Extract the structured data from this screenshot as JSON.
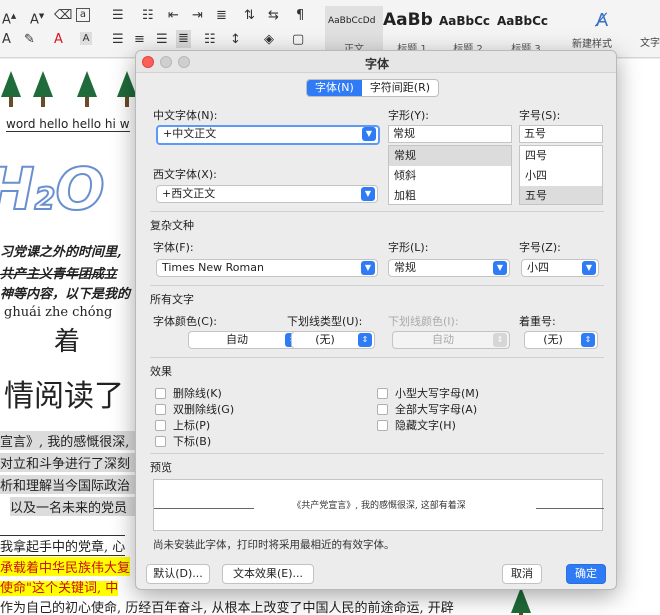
{
  "ribbon": {
    "styles": [
      {
        "sample": "AaBbCcDd",
        "name": "正文"
      },
      {
        "sample": "AaBb",
        "name": "标题 1"
      },
      {
        "sample": "AaBbCc",
        "name": "标题 2"
      },
      {
        "sample": "AaBbCc",
        "name": "标题 3"
      }
    ],
    "new_style_label": "新建样式",
    "text_label": "文字"
  },
  "document": {
    "line1": "word hello hello hi w",
    "line2": "习党课之外的时间里,",
    "line3": "共产主义青年团成立",
    "line4": "神等内容，以下是我的",
    "pinyin": "ghuái zhe chóng",
    "char_big": "着",
    "line5": "情阅读了",
    "para1": "宣言》, 我的感慨很深,",
    "para2": "对立和斗争进行了深刻",
    "para3": "析和理解当今国际政治",
    "para4": "以及一名未来的党员",
    "para5": "我拿起手中的党章, 心",
    "para6": "承载着中华民族伟大复",
    "para7": "使命\"这个关键词, 中",
    "para8": "作为自己的初心使命, 历经百年奋斗, 从根本上改变了中国人民的前途命运, 开辟"
  },
  "dialog": {
    "title": "字体",
    "tabs": [
      {
        "label": "字体(N)",
        "active": true
      },
      {
        "label": "字符间距(R)",
        "active": false
      }
    ],
    "chinese_font_label": "中文字体(N):",
    "chinese_font_value": "+中文正文",
    "western_font_label": "西文字体(X):",
    "western_font_value": "+西文正文",
    "style_label": "字形(Y):",
    "style_value": "常规",
    "style_options": [
      "常规",
      "倾斜",
      "加粗"
    ],
    "size_label": "字号(S):",
    "size_value": "五号",
    "size_options": [
      "四号",
      "小四",
      "五号"
    ],
    "complex_section": "复杂文种",
    "complex_font_label": "字体(F):",
    "complex_font_value": "Times New Roman",
    "complex_style_label": "字形(L):",
    "complex_style_value": "常规",
    "complex_size_label": "字号(Z):",
    "complex_size_value": "小四",
    "all_text_section": "所有文字",
    "font_color_label": "字体颜色(C):",
    "font_color_value": "自动",
    "underline_type_label": "下划线类型(U):",
    "underline_type_value": "(无)",
    "underline_color_label": "下划线颜色(I):",
    "underline_color_value": "自动",
    "emphasis_label": "着重号:",
    "emphasis_value": "(无)",
    "effects_section": "效果",
    "effects_left": [
      "删除线(K)",
      "双删除线(G)",
      "上标(P)",
      "下标(B)"
    ],
    "effects_right": [
      "小型大写字母(M)",
      "全部大写字母(A)",
      "隐藏文字(H)"
    ],
    "preview_section": "预览",
    "preview_text": "《共产党宣言》, 我的感慨很深, 这部有着深",
    "note": "尚未安装此字体，打印时将采用最相近的有效字体。",
    "buttons": {
      "default": "默认(D)...",
      "text_effects": "文本效果(E)...",
      "cancel": "取消",
      "ok": "确定"
    }
  },
  "colors": {
    "accent": "#2f7bf5",
    "highlight": "#ffff00",
    "selection": "#dcdcdc"
  }
}
